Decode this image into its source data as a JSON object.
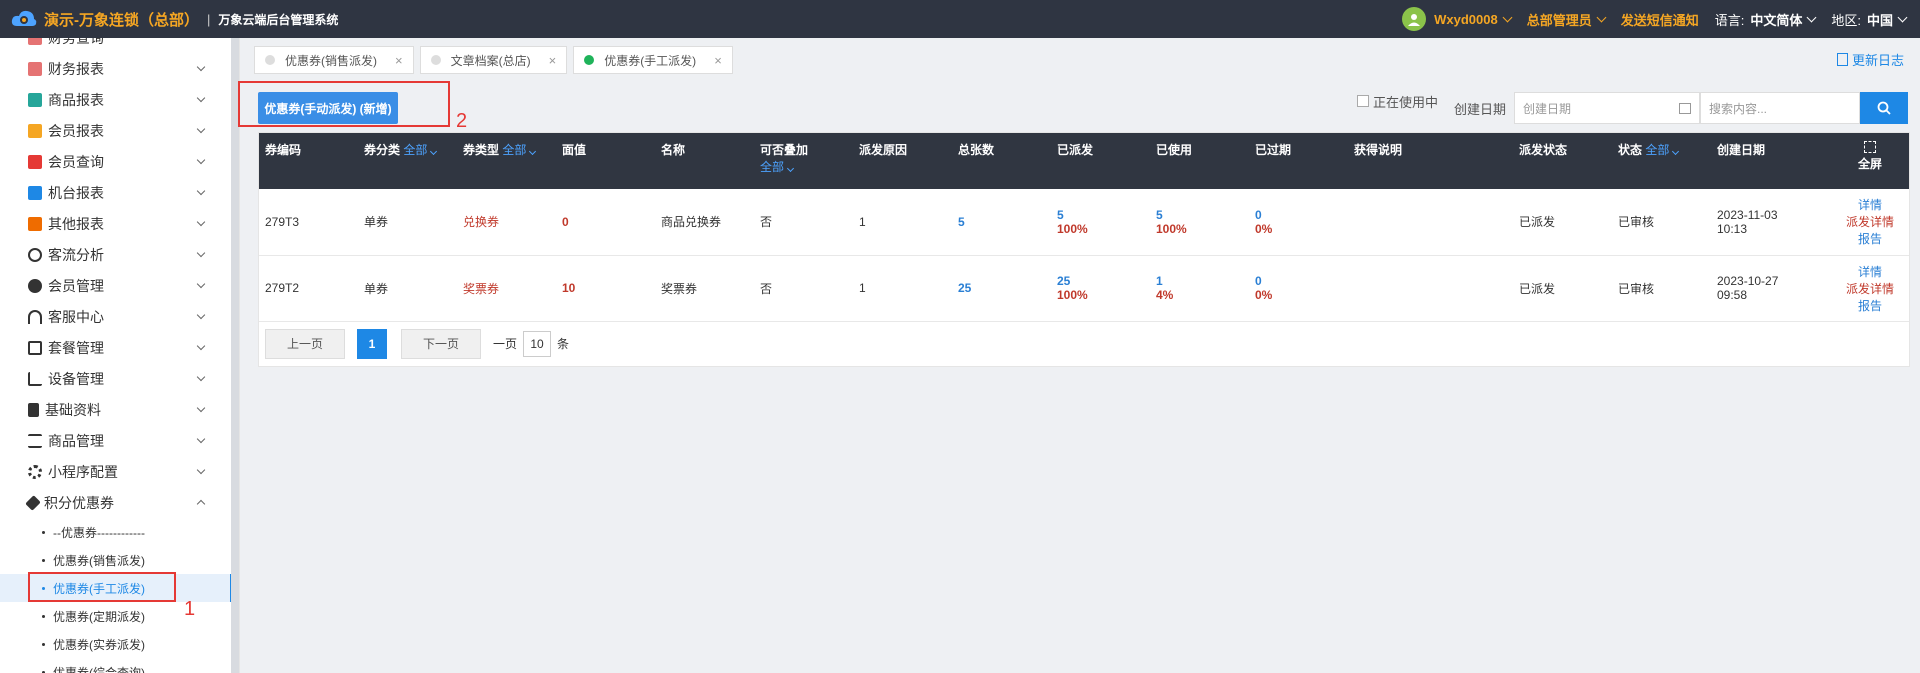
{
  "header": {
    "brand": "演示-万象连锁（总部）",
    "separator": "|",
    "system_name": "万象云端后台管理系统",
    "user": "Wxyd0008",
    "role": "总部管理员",
    "sms": "发送短信通知",
    "lang_label": "语言:",
    "lang_value": "中文简体",
    "region_label": "地区:",
    "region_value": "中国"
  },
  "sidebar": {
    "items": [
      {
        "label": "财务查询",
        "icon_color": "#e57373"
      },
      {
        "label": "财务报表",
        "icon_color": "#e57373"
      },
      {
        "label": "商品报表",
        "icon_color": "#26a69a"
      },
      {
        "label": "会员报表",
        "icon_color": "#f5a623"
      },
      {
        "label": "会员查询",
        "icon_color": "#e53935"
      },
      {
        "label": "机台报表",
        "icon_color": "#1e88e5"
      },
      {
        "label": "其他报表",
        "icon_color": "#ef6c00"
      },
      {
        "label": "客流分析",
        "icon_color": "#333333"
      },
      {
        "label": "会员管理",
        "icon_color": "#333333"
      },
      {
        "label": "客服中心",
        "icon_color": "#333333"
      },
      {
        "label": "套餐管理",
        "icon_color": "#333333"
      },
      {
        "label": "设备管理",
        "icon_color": "#333333"
      },
      {
        "label": "基础资料",
        "icon_color": "#333333"
      },
      {
        "label": "商品管理",
        "icon_color": "#333333"
      },
      {
        "label": "小程序配置",
        "icon_color": "#333333"
      },
      {
        "label": "积分优惠券",
        "icon_color": "#333333"
      }
    ],
    "sub_items": [
      "--优惠券------------",
      "优惠券(销售派发)",
      "优惠券(手工派发)",
      "优惠券(定期派发)",
      "优惠券(实券派发)",
      "优惠券(综合查询)"
    ]
  },
  "tabs": [
    {
      "label": "优惠券(销售派发)",
      "close": "×"
    },
    {
      "label": "文章档案(总店)",
      "close": "×"
    },
    {
      "label": "优惠券(手工派发)",
      "close": "×"
    }
  ],
  "update_log": "更新日志",
  "toolbar": {
    "new_button": "优惠券(手动派发) (新增)",
    "in_use": "正在使用中",
    "date_label": "创建日期",
    "date_placeholder": "创建日期",
    "search_placeholder": "搜索内容..."
  },
  "annotations": {
    "one": "1",
    "two": "2"
  },
  "table": {
    "headers": {
      "code": "券编码",
      "category": "券分类",
      "category_filter": "全部",
      "type": "券类型",
      "type_filter": "全部",
      "face": "面值",
      "name": "名称",
      "stackable": "可否叠加",
      "stackable_filter": "全部",
      "reason": "派发原因",
      "total": "总张数",
      "issued": "已派发",
      "used": "已使用",
      "expired": "已过期",
      "desc": "获得说明",
      "dist_status": "派发状态",
      "status": "状态",
      "status_filter": "全部",
      "created": "创建日期",
      "fullscreen": "全屏"
    },
    "rows": [
      {
        "code": "279T3",
        "category": "单券",
        "type": "兑换券",
        "face": "0",
        "name": "商品兑换券",
        "stackable": "否",
        "reason": "1",
        "total": "5",
        "issued": "5",
        "issued_pct": "100%",
        "used": "5",
        "used_pct": "100%",
        "expired": "0",
        "expired_pct": "0%",
        "desc": "",
        "dist_status": "已派发",
        "status": "已审核",
        "created_date": "2023-11-03",
        "created_time": "10:13",
        "act_detail": "详情",
        "act_dist": "派发详情",
        "act_report": "报告"
      },
      {
        "code": "279T2",
        "category": "单券",
        "type": "奖票券",
        "face": "10",
        "name": "奖票券",
        "stackable": "否",
        "reason": "1",
        "total": "25",
        "issued": "25",
        "issued_pct": "100%",
        "used": "1",
        "used_pct": "4%",
        "expired": "0",
        "expired_pct": "0%",
        "desc": "",
        "dist_status": "已派发",
        "status": "已审核",
        "created_date": "2023-10-27",
        "created_time": "09:58",
        "act_detail": "详情",
        "act_dist": "派发详情",
        "act_report": "报告"
      }
    ]
  },
  "pager": {
    "prev": "上一页",
    "current": "1",
    "next": "下一页",
    "per_page_label": "一页",
    "per_page": "10",
    "unit": "条"
  }
}
